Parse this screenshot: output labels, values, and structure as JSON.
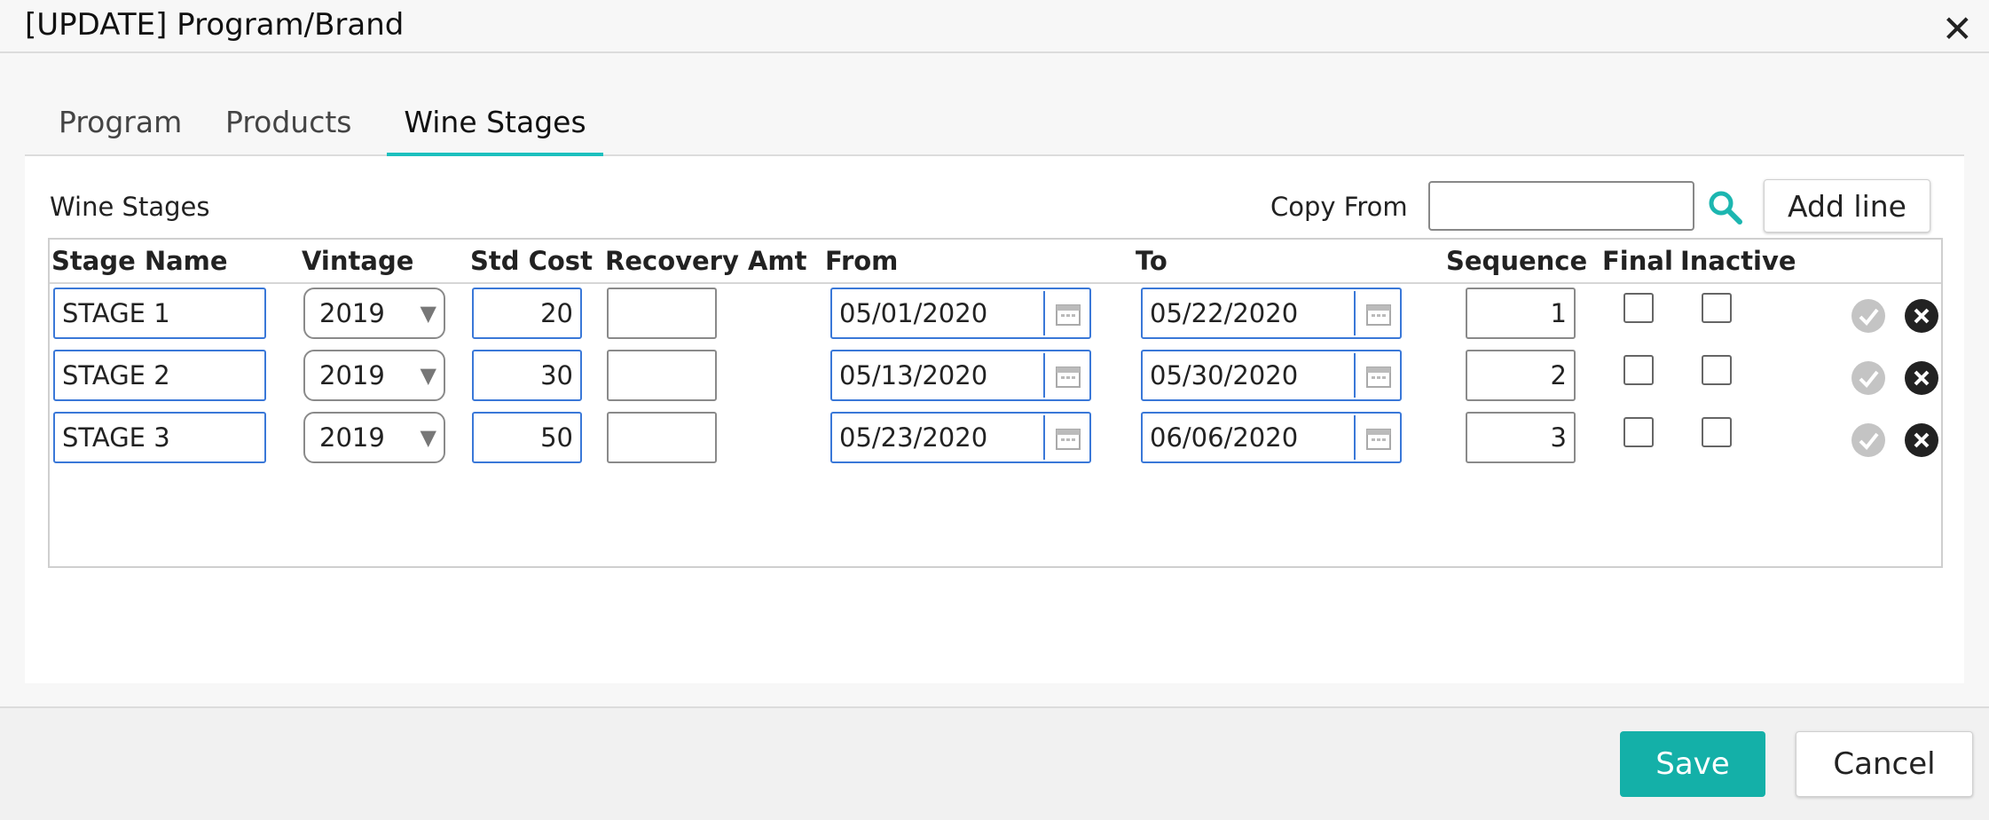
{
  "dialog": {
    "title": "[UPDATE] Program/Brand",
    "close_icon": "close-icon"
  },
  "tabs": [
    {
      "label": "Program",
      "active": false
    },
    {
      "label": "Products",
      "active": false
    },
    {
      "label": "Wine Stages",
      "active": true
    }
  ],
  "wine_stages": {
    "section_title": "Wine Stages",
    "copy_from_label": "Copy From",
    "copy_from_value": "",
    "search_icon": "search-icon",
    "add_line_label": "Add line",
    "columns": [
      "Stage Name",
      "Vintage",
      "Std Cost",
      "Recovery Amt",
      "From",
      "To",
      "Sequence",
      "Final",
      "Inactive"
    ],
    "rows": [
      {
        "stage_name": "STAGE 1",
        "vintage": "2019",
        "std_cost": "20",
        "recovery_amt": "",
        "from": "05/01/2020",
        "to": "05/22/2020",
        "sequence": "1",
        "final": false,
        "inactive": false
      },
      {
        "stage_name": "STAGE 2",
        "vintage": "2019",
        "std_cost": "30",
        "recovery_amt": "",
        "from": "05/13/2020",
        "to": "05/30/2020",
        "sequence": "2",
        "final": false,
        "inactive": false
      },
      {
        "stage_name": "STAGE 3",
        "vintage": "2019",
        "std_cost": "50",
        "recovery_amt": "",
        "from": "05/23/2020",
        "to": "06/06/2020",
        "sequence": "3",
        "final": false,
        "inactive": false
      }
    ]
  },
  "footer": {
    "save_label": "Save",
    "cancel_label": "Cancel"
  },
  "colors": {
    "accent": "#14b0a8",
    "tab_underline": "#1cc0be",
    "input_border_active": "#3a78d8"
  }
}
